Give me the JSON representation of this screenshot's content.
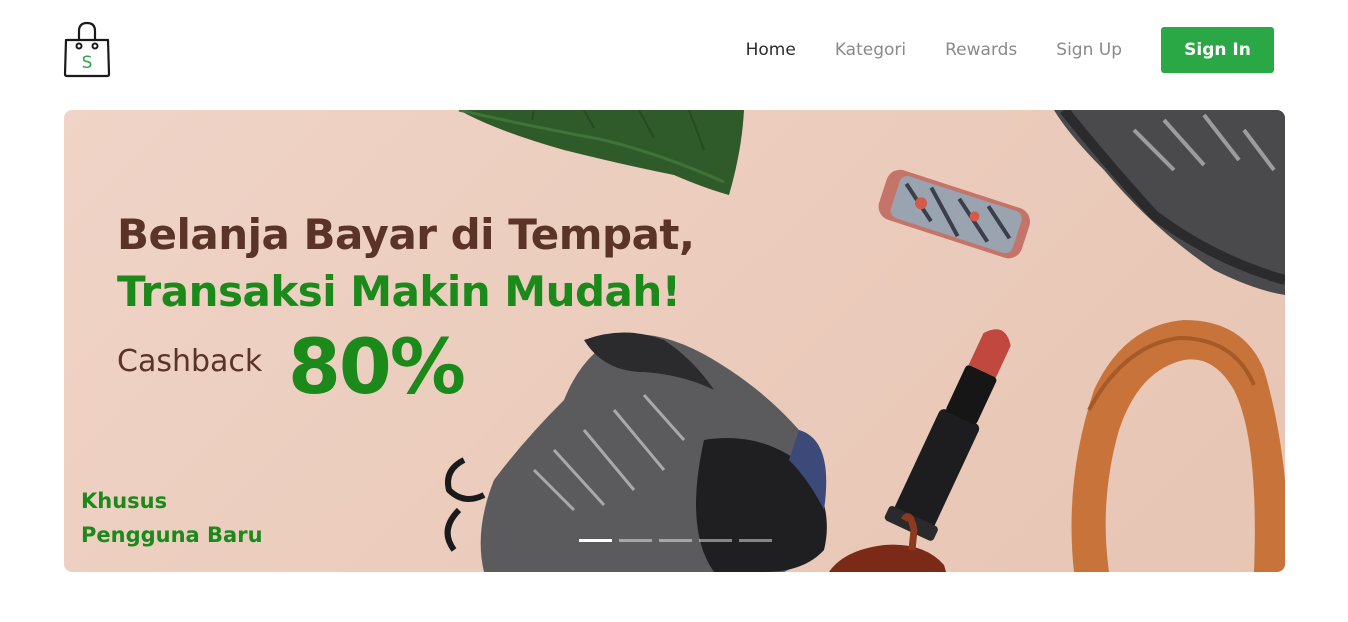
{
  "brand": {
    "logo_letter": "S",
    "accent_color": "#2aa845"
  },
  "nav": {
    "items": [
      {
        "label": "Home",
        "active": true
      },
      {
        "label": "Kategori",
        "active": false
      },
      {
        "label": "Rewards",
        "active": false
      },
      {
        "label": "Sign Up",
        "active": false
      }
    ],
    "signin_label": "Sign In"
  },
  "banner": {
    "headline_1": "Belanja Bayar di Tempat,",
    "headline_2": "Transaksi Makin Mudah!",
    "cashback_label": "Cashback",
    "cashback_value": "80%",
    "promo_1": "Khusus",
    "promo_2": "Pengguna Baru",
    "headline_color": "#5a3426",
    "highlight_color": "#1b8a1b",
    "slide_count": 5,
    "active_slide": 1
  }
}
